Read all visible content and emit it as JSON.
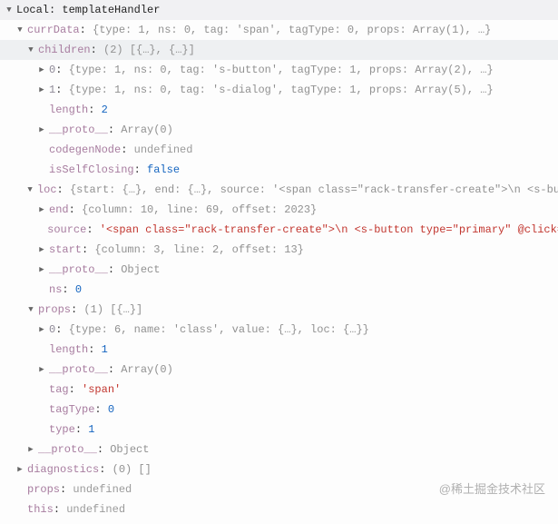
{
  "header": {
    "label": "Local: templateHandler"
  },
  "tree": {
    "currData": {
      "label": "currData",
      "preview": "{type: 1, ns: 0, tag: 'span', tagType: 0, props: Array(1), …}",
      "children": {
        "label": "children",
        "summary": "(2) [{…}, {…}]",
        "items": [
          {
            "idx": "0",
            "preview": "{type: 1, ns: 0, tag: 's-button', tagType: 1, props: Array(2), …}"
          },
          {
            "idx": "1",
            "preview": "{type: 1, ns: 0, tag: 's-dialog', tagType: 1, props: Array(5), …}"
          }
        ],
        "length": {
          "label": "length",
          "value": "2"
        },
        "proto": {
          "label": "__proto__",
          "value": "Array(0)"
        }
      },
      "codegenNode": {
        "label": "codegenNode",
        "value": "undefined"
      },
      "isSelfClosing": {
        "label": "isSelfClosing",
        "value": "false"
      },
      "loc": {
        "label": "loc",
        "preview": "{start: {…}, end: {…}, source: '<span class=\"rack-transfer-create\">\\n    <s-bu……",
        "end": {
          "label": "end",
          "preview": "{column: 10, line: 69, offset: 2023}"
        },
        "source": {
          "label": "source",
          "value": "'<span class=\"rack-transfer-create\">\\n    <s-button type=\"primary\" @click=\"…"
        },
        "start": {
          "label": "start",
          "preview": "{column: 3, line: 2, offset: 13}"
        },
        "proto": {
          "label": "__proto__",
          "value": "Object"
        }
      },
      "ns": {
        "label": "ns",
        "value": "0"
      },
      "props": {
        "label": "props",
        "summary": "(1) [{…}]",
        "items": [
          {
            "idx": "0",
            "preview": "{type: 6, name: 'class', value: {…}, loc: {…}}"
          }
        ],
        "length": {
          "label": "length",
          "value": "1"
        },
        "proto": {
          "label": "__proto__",
          "value": "Array(0)"
        }
      },
      "tag": {
        "label": "tag",
        "value": "'span'"
      },
      "tagType": {
        "label": "tagType",
        "value": "0"
      },
      "type": {
        "label": "type",
        "value": "1"
      },
      "proto": {
        "label": "__proto__",
        "value": "Object"
      }
    },
    "diagnostics": {
      "label": "diagnostics",
      "summary": "(0) []"
    },
    "propsScope": {
      "label": "props",
      "value": "undefined"
    },
    "thisScope": {
      "label": "this",
      "value": "undefined"
    }
  },
  "watermark": "@稀土掘金技术社区"
}
